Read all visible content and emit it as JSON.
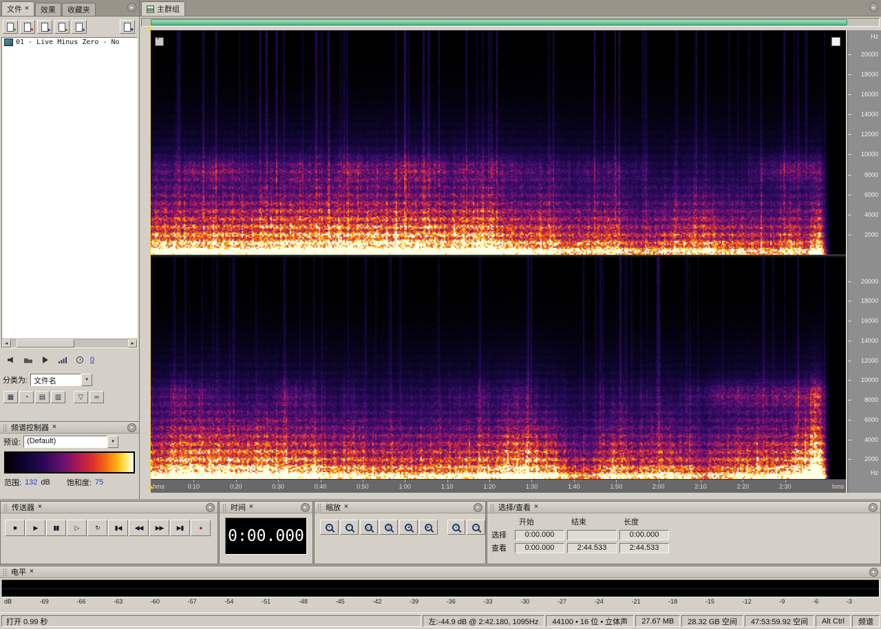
{
  "ui": {
    "close_glyph": "×",
    "menu_arrow": "▸",
    "dropdown_arrow": "▼",
    "scroll_left": "◂",
    "scroll_right": "▸"
  },
  "colors": {
    "scrollbar_green": "#6fcf97",
    "playhead_yellow": "#f0d23a",
    "record_red": "#cc2222",
    "value_blue": "#2040c0"
  },
  "files_panel": {
    "tabs": [
      {
        "id": "files",
        "label": "文件",
        "close": "×"
      },
      {
        "id": "effects",
        "label": "效果"
      },
      {
        "id": "favorites",
        "label": "收藏夹"
      }
    ],
    "toolbar": [
      {
        "id": "import-file-button",
        "icon": "import-file-icon",
        "mark": "+",
        "color": "#1f7a1f"
      },
      {
        "id": "close-file-button",
        "icon": "close-file-icon",
        "mark": "×",
        "color": "#b02020"
      },
      {
        "id": "edit-file-button",
        "icon": "edit-file-icon",
        "mark": "▸",
        "color": "#23408f"
      },
      {
        "id": "insert-into-multitrack-button",
        "icon": "insert-multitrack-icon",
        "mark": "▸",
        "color": "#8a6a1a"
      },
      {
        "id": "insert-into-cd-button",
        "icon": "insert-cd-icon",
        "mark": "●",
        "color": "#666"
      },
      {
        "id": "dock-options-button",
        "icon": "dock-options-icon",
        "mark": "▾",
        "color": "#333"
      }
    ],
    "file_list": [
      {
        "label": "01 - Live Minus Zero - No"
      }
    ],
    "media_buttons": [
      {
        "id": "autoplay-button",
        "icon": "speaker-icon"
      },
      {
        "id": "open-folder-button",
        "icon": "folder-icon"
      },
      {
        "id": "preview-play-button",
        "icon": "play-icon"
      },
      {
        "id": "preview-volume-button",
        "icon": "volume-bars-icon"
      },
      {
        "id": "preview-timer-button",
        "icon": "clock-icon"
      }
    ],
    "autoplay_count": "0",
    "sort_label": "分类为:",
    "sort_value": "文件名",
    "view_buttons": [
      {
        "id": "toggle-list-view-button",
        "glyph": "▦"
      },
      {
        "id": "toggle-recent-button",
        "glyph": "◔"
      },
      {
        "id": "show-audio-files-button",
        "glyph": "▤"
      },
      {
        "id": "show-video-files-button",
        "glyph": "▥"
      },
      {
        "id": "filter-options-button",
        "glyph": "▽"
      },
      {
        "id": "show-loops-button",
        "glyph": "∞"
      }
    ]
  },
  "spectral_panel": {
    "title": "频谱控制器",
    "preset_label": "预设:",
    "preset_value": "(Default)",
    "range_label": "范围:",
    "range_value": "132",
    "range_unit": "dB",
    "sat_label": "饱和度:",
    "sat_value": "75"
  },
  "main": {
    "tab_label": "主群组",
    "hz_label": "Hz",
    "freq_ticks": [
      "20000",
      "18000",
      "16000",
      "14000",
      "12000",
      "10000",
      "8000",
      "6000",
      "4000",
      "2000"
    ],
    "hms_label": "hms",
    "time_ticks": [
      "0:10",
      "0:20",
      "0:30",
      "0:40",
      "0:50",
      "1:00",
      "1:10",
      "1:20",
      "1:30",
      "1:40",
      "1:50",
      "2:00",
      "2:10",
      "2:20",
      "2:30"
    ]
  },
  "transport": {
    "title": "传送器",
    "buttons": [
      {
        "id": "stop-button",
        "icon": "stop-icon",
        "glyph": "■"
      },
      {
        "id": "play-button",
        "icon": "play-icon",
        "glyph": "▶"
      },
      {
        "id": "pause-button",
        "icon": "pause-icon",
        "glyph": "▮▮"
      },
      {
        "id": "play-from-cursor-button",
        "icon": "play-circle-icon",
        "glyph": "▷"
      },
      {
        "id": "loop-play-button",
        "icon": "loop-icon",
        "glyph": "↻"
      },
      {
        "id": "go-to-start-button",
        "icon": "go-start-icon",
        "glyph": "▮◀"
      },
      {
        "id": "rewind-button",
        "icon": "rewind-icon",
        "glyph": "◀◀"
      },
      {
        "id": "fast-forward-button",
        "icon": "fast-forward-icon",
        "glyph": "▶▶"
      },
      {
        "id": "go-to-end-button",
        "icon": "go-end-icon",
        "glyph": "▶▮"
      },
      {
        "id": "record-button",
        "icon": "record-icon",
        "glyph": "●",
        "color": "#cc2222"
      }
    ]
  },
  "time_panel": {
    "title": "时间",
    "value": "0:00.000"
  },
  "zoom": {
    "title": "缩放",
    "buttons": [
      {
        "id": "zoom-in-horizontal-button",
        "icon": "magnifier-plus-icon",
        "sign": "+"
      },
      {
        "id": "zoom-out-horizontal-button",
        "icon": "magnifier-minus-icon",
        "sign": "−"
      },
      {
        "id": "zoom-full-button",
        "icon": "magnifier-full-icon",
        "sign": "▭"
      },
      {
        "id": "zoom-selection-button",
        "icon": "magnifier-selection-icon",
        "sign": "▯"
      },
      {
        "id": "zoom-selection-left-button",
        "icon": "magnifier-left-icon",
        "sign": "◂"
      },
      {
        "id": "zoom-selection-right-button",
        "icon": "magnifier-right-icon",
        "sign": "▸"
      },
      {
        "id": "zoom-in-vertical-button",
        "icon": "magnifier-vplus-icon",
        "sign": "+"
      },
      {
        "id": "zoom-out-vertical-button",
        "icon": "magnifier-vminus-icon",
        "sign": "−"
      }
    ]
  },
  "selection_panel": {
    "title": "选择/查看",
    "headers": [
      "开始",
      "结束",
      "长度"
    ],
    "rows": [
      {
        "id": "selection",
        "label": "选择",
        "values": [
          "0:00.000",
          "",
          "0:00.000"
        ]
      },
      {
        "id": "view",
        "label": "查看",
        "values": [
          "0:00.000",
          "2:44.533",
          "2:44.533"
        ]
      }
    ]
  },
  "levels_panel": {
    "title": "电平",
    "scale": [
      "dB",
      "-69",
      "-66",
      "-63",
      "-60",
      "-57",
      "-54",
      "-51",
      "-48",
      "-45",
      "-42",
      "-39",
      "-36",
      "-33",
      "-30",
      "-27",
      "-24",
      "-21",
      "-18",
      "-15",
      "-12",
      "-9",
      "-6",
      "-3"
    ]
  },
  "status_bar": {
    "items": [
      {
        "id": "status-message",
        "text": "打开 0.99 秒"
      },
      {
        "id": "cursor-info",
        "text": "左:-44.9 dB @ 2:42.180, 1095Hz"
      },
      {
        "id": "format-info",
        "text": "44100 • 16 位 • 立体声"
      },
      {
        "id": "file-size",
        "text": "27.67 MB"
      },
      {
        "id": "disk-space",
        "text": "28.32 GB 空间"
      },
      {
        "id": "disk-time-space",
        "text": "47:53:59.92 空间"
      },
      {
        "id": "modifier-keys",
        "text": "Alt Ctrl"
      },
      {
        "id": "view-mode",
        "text": "频谱"
      }
    ]
  }
}
